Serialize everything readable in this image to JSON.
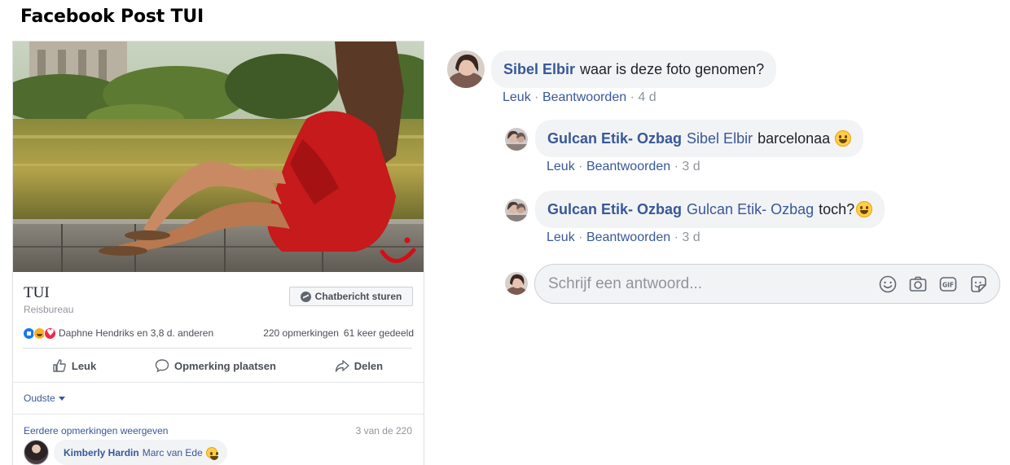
{
  "page_title": "Facebook Post TUI",
  "post": {
    "page_name": "TUI",
    "page_category": "Reisbureau",
    "message_button": "Chatbericht sturen",
    "reactions_text": "Daphne Hendriks en 3,8 d. anderen",
    "comments_count": "220 opmerkingen",
    "shares_count": "61 keer gedeeld",
    "actions": {
      "like": "Leuk",
      "comment": "Opmerking plaatsen",
      "share": "Delen"
    },
    "sort_label": "Oudste",
    "more_comments": "Eerdere opmerkingen weergeven",
    "comment_counter": "3 van de 220",
    "preview_comment": {
      "author": "Kimberly Hardin",
      "tag": "Marc van Ede"
    }
  },
  "comments": [
    {
      "author": "Sibel Elbir",
      "text": "waar is deze foto genomen?",
      "like": "Leuk",
      "reply": "Beantwoorden",
      "time": "4 d"
    }
  ],
  "replies": [
    {
      "author": "Gulcan Etik- Ozbag",
      "tag": "Sibel Elbir",
      "text": "barcelonaa",
      "like": "Leuk",
      "reply": "Beantwoorden",
      "time": "3 d"
    },
    {
      "author": "Gulcan Etik- Ozbag",
      "tag": "Gulcan Etik- Ozbag",
      "text": "toch?",
      "like": "Leuk",
      "reply": "Beantwoorden",
      "time": "3 d"
    }
  ],
  "reply_input": {
    "placeholder": "Schrijf een antwoord..."
  },
  "colors": {
    "link": "#385898",
    "bubble": "#f2f3f5",
    "tui_red": "#d40e14"
  }
}
